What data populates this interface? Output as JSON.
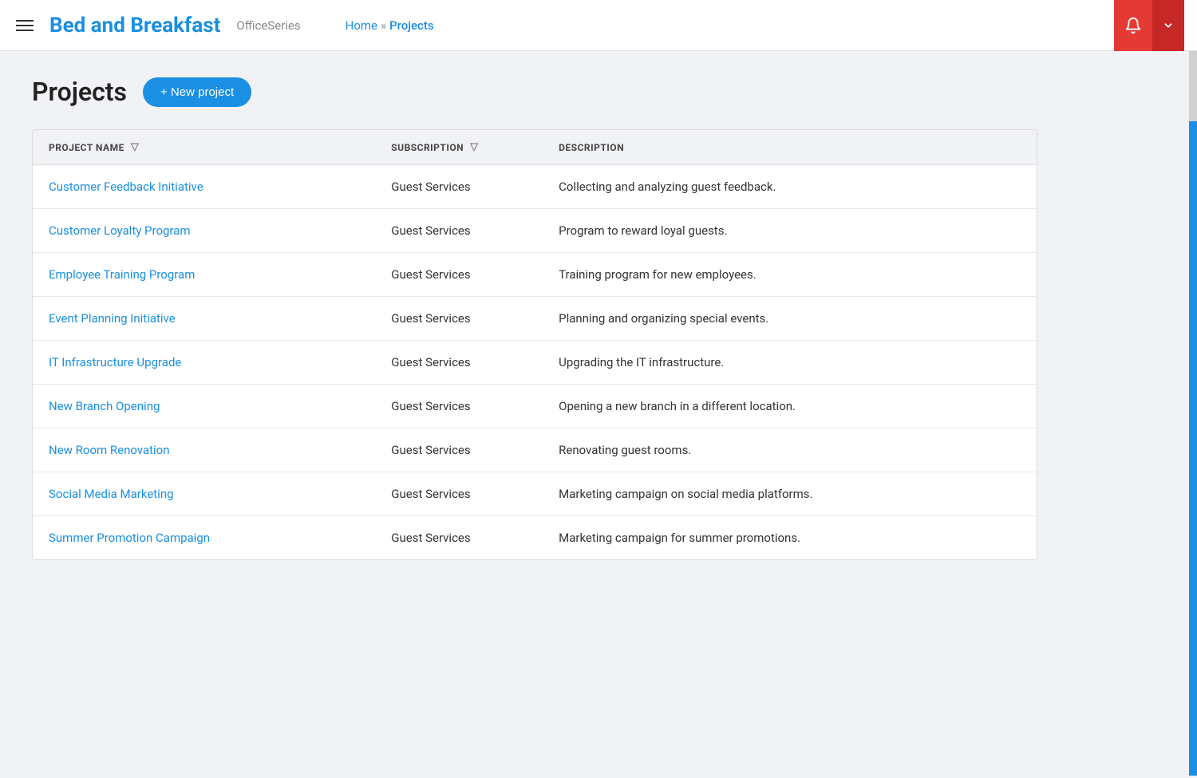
{
  "header": {
    "brand_name": "Bed and Breakfast",
    "brand_series": "OfficeSeries",
    "breadcrumb_home": "Home",
    "breadcrumb_sep": "»",
    "breadcrumb_current": "Projects"
  },
  "page": {
    "title": "Projects",
    "new_project_label": "+ New project"
  },
  "table": {
    "columns": [
      {
        "id": "project_name",
        "label": "PROJECT NAME",
        "has_filter": true
      },
      {
        "id": "subscription",
        "label": "SUBSCRIPTION",
        "has_filter": true
      },
      {
        "id": "description",
        "label": "DESCRIPTION",
        "has_filter": false
      }
    ],
    "rows": [
      {
        "name": "Customer Feedback Initiative",
        "subscription": "Guest Services",
        "description": "Collecting and analyzing guest feedback."
      },
      {
        "name": "Customer Loyalty Program",
        "subscription": "Guest Services",
        "description": "Program to reward loyal guests."
      },
      {
        "name": "Employee Training Program",
        "subscription": "Guest Services",
        "description": "Training program for new employees."
      },
      {
        "name": "Event Planning Initiative",
        "subscription": "Guest Services",
        "description": "Planning and organizing special events."
      },
      {
        "name": "IT Infrastructure Upgrade",
        "subscription": "Guest Services",
        "description": "Upgrading the IT infrastructure."
      },
      {
        "name": "New Branch Opening",
        "subscription": "Guest Services",
        "description": "Opening a new branch in a different location."
      },
      {
        "name": "New Room Renovation",
        "subscription": "Guest Services",
        "description": "Renovating guest rooms."
      },
      {
        "name": "Social Media Marketing",
        "subscription": "Guest Services",
        "description": "Marketing campaign on social media platforms."
      },
      {
        "name": "Summer Promotion Campaign",
        "subscription": "Guest Services",
        "description": "Marketing campaign for summer promotions."
      }
    ]
  }
}
